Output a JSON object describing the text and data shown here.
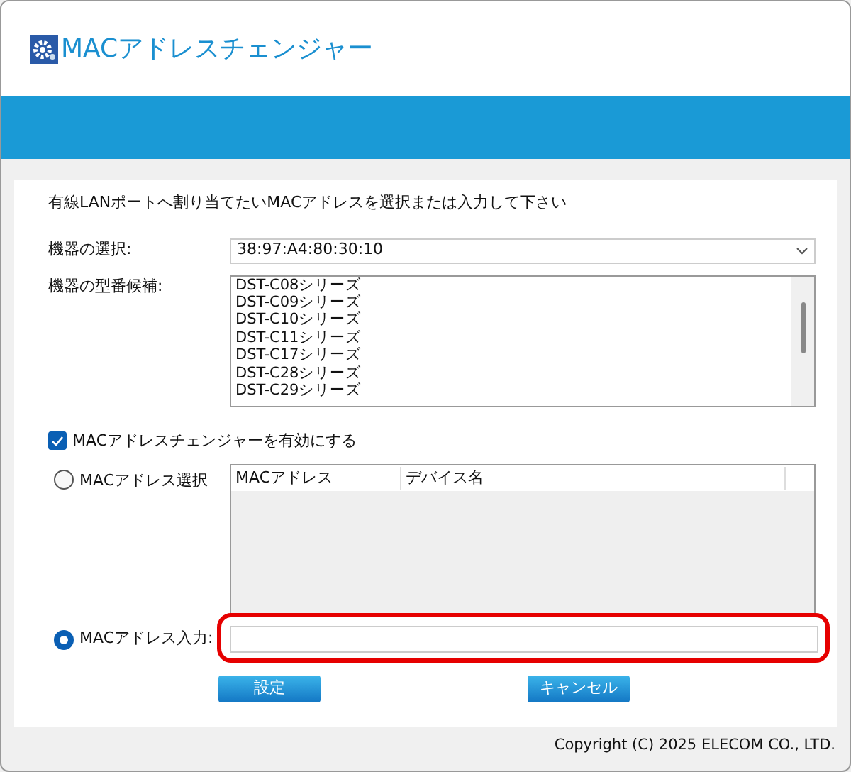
{
  "header": {
    "title": "MACアドレスチェンジャー"
  },
  "instruction": "有線LANポートへ割り当てたいMACアドレスを選択または入力して下さい",
  "device_select": {
    "label": "機器の選択:",
    "value": "38:97:A4:80:30:10"
  },
  "model_candidates": {
    "label": "機器の型番候補:",
    "items": [
      "DST-C08シリーズ",
      "DST-C09シリーズ",
      "DST-C10シリーズ",
      "DST-C11シリーズ",
      "DST-C17シリーズ",
      "DST-C28シリーズ",
      "DST-C29シリーズ"
    ]
  },
  "enable_checkbox": {
    "label": "MACアドレスチェンジャーを有効にする",
    "checked": true
  },
  "mac_options": [
    {
      "kind": "table",
      "label": "MACアドレス選択",
      "selected": false,
      "columns": [
        "MACアドレス",
        "デバイス名"
      ]
    },
    {
      "kind": "input",
      "label": "MACアドレス入力:",
      "selected": true
    }
  ],
  "buttons": [
    "設定",
    "キャンセル"
  ],
  "footer": "Copyright (C) 2025 ELECOM CO., LTD."
}
